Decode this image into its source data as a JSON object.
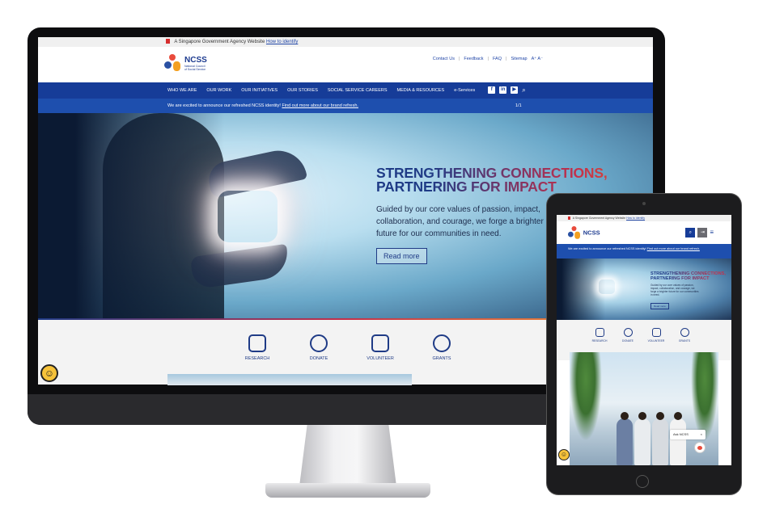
{
  "desktop": {
    "gov_banner": {
      "text": "A Singapore Government Agency Website",
      "link": "How to identify"
    },
    "logo": {
      "name": "NCSS",
      "tagline_1": "National Council",
      "tagline_2": "of Social Service"
    },
    "top_links": [
      "Contact Us",
      "Feedback",
      "FAQ",
      "Sitemap",
      "A⁺ A⁻"
    ],
    "nav": [
      "WHO WE ARE",
      "OUR WORK",
      "OUR INITIATIVES",
      "OUR STORIES",
      "SOCIAL SERVICE CAREERS",
      "MEDIA & RESOURCES",
      "e-Services"
    ],
    "nav_icons": [
      "facebook-icon",
      "linkedin-icon",
      "youtube-icon",
      "search-icon"
    ],
    "announcement": {
      "text": "We are excited to announce our refreshed NCSS identity!",
      "link": "Find out more about our brand refresh.",
      "counter": "1/1"
    },
    "hero": {
      "title_line1": "STRENGTHENING CONNECTIONS,",
      "title_line2": "PARTNERING FOR IMPACT",
      "subtitle": "Guided by our core values of passion, impact, collaboration, and courage, we forge a brighter future for our communities in need.",
      "button": "Read more"
    },
    "quick_links": [
      "RESEARCH",
      "DONATE",
      "VOLUNTEER",
      "GRANTS"
    ]
  },
  "tablet": {
    "gov_banner": {
      "text": "A Singapore Government Agency Website",
      "link": "How to identify"
    },
    "logo": {
      "name": "NCSS"
    },
    "announcement": {
      "text": "We are excited to announce our refreshed NCSS identity!",
      "link": "Find out more about our brand refresh."
    },
    "hero": {
      "title_line1": "STRENGTHENING CONNECTIONS,",
      "title_line2": "PARTNERING FOR IMPACT",
      "subtitle": "Guided by our core values of passion, impact, collaboration, and courage, we forge a brighter future for our communities in need.",
      "button": "Read more"
    },
    "quick_links": [
      "RESEARCH",
      "DONATE",
      "VOLUNTEER",
      "GRANTS"
    ],
    "chat": {
      "label": "Ask NCSS",
      "close": "×"
    }
  },
  "colors": {
    "primary": "#163c98",
    "accent_red": "#c4304a",
    "accent_orange": "#f19e34"
  }
}
